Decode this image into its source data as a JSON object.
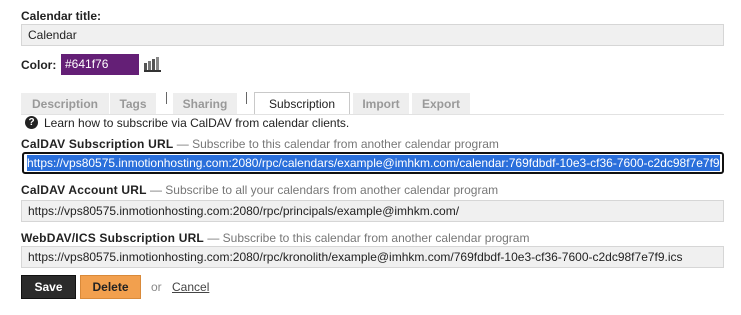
{
  "calendar_title": {
    "label": "Calendar title:",
    "value": "Calendar"
  },
  "color": {
    "label": "Color:",
    "value": "#641f76",
    "swatch": "#641f76"
  },
  "tabs": [
    {
      "label": "Description"
    },
    {
      "label": "Tags"
    },
    {
      "label": "Sharing"
    },
    {
      "label": "Subscription"
    },
    {
      "label": "Import"
    },
    {
      "label": "Export"
    }
  ],
  "help": {
    "icon": "?",
    "text": "Learn how to subscribe via CalDAV from calendar clients."
  },
  "caldav_subscription": {
    "label": "CalDAV Subscription URL",
    "desc": "— Subscribe to this calendar from another calendar program",
    "value": "https://vps80575.inmotionhosting.com:2080/rpc/calendars/example@imhkm.com/calendar:769fdbdf-10e3-cf36-7600-c2dc98f7e7f9"
  },
  "caldav_account": {
    "label": "CalDAV Account URL",
    "desc": "— Subscribe to all your calendars from another calendar program",
    "value": "https://vps80575.inmotionhosting.com:2080/rpc/principals/example@imhkm.com/"
  },
  "webdav_ics": {
    "label": "WebDAV/ICS Subscription URL",
    "desc": "— Subscribe to this calendar from another calendar program",
    "value": "https://vps80575.inmotionhosting.com:2080/rpc/kronolith/example@imhkm.com/769fdbdf-10e3-cf36-7600-c2dc98f7e7f9.ics"
  },
  "actions": {
    "save": "Save",
    "delete": "Delete",
    "or": "or",
    "cancel": "Cancel"
  }
}
